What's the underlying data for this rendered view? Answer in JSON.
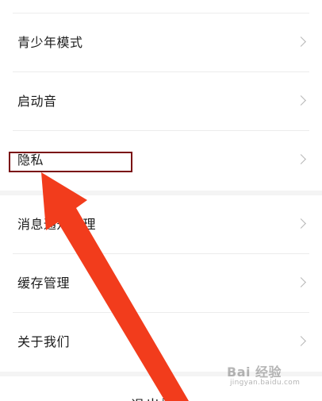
{
  "settings": {
    "items": [
      {
        "label": "青少年模式"
      },
      {
        "label": "启动音"
      },
      {
        "label": "隐私"
      },
      {
        "label": "消息通知管理"
      },
      {
        "label": "缓存管理"
      },
      {
        "label": "关于我们"
      }
    ],
    "logout_label": "退出登录"
  },
  "watermark": {
    "logo": "Bai 经验",
    "sub": "jingyan.baidu.com"
  },
  "annotation": {
    "box_color": "#7a0d12",
    "arrow_color": "#f23c1c"
  },
  "icons": {
    "chevron": "chevron-right-icon"
  }
}
